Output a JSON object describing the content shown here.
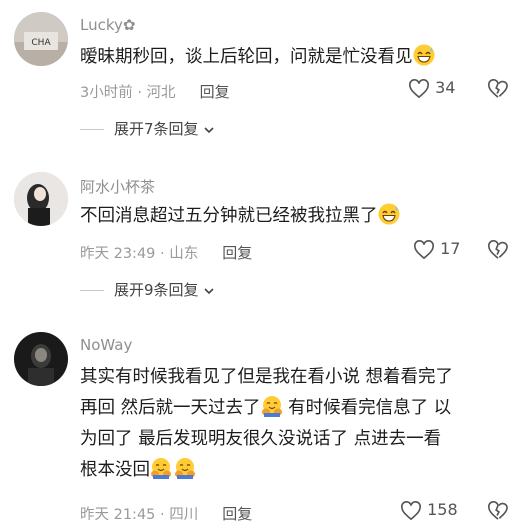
{
  "comments": [
    {
      "username": "Lucky✿",
      "text": "暧昧期秒回，谈上后轮回，问就是忙没看见",
      "emoji_after": "grinning-sweat",
      "time_location": "3小时前 · 河北",
      "reply_label": "回复",
      "likes": "34",
      "expand_label": "展开7条回复"
    },
    {
      "username": "阿水小杯茶",
      "text": "不回消息超过五分钟就已经被我拉黑了",
      "emoji_after": "grinning-sweat",
      "time_location": "昨天 23:49 · 山东",
      "reply_label": "回复",
      "likes": "17",
      "expand_label": "展开9条回复"
    },
    {
      "username": "NoWay",
      "text_line1": "其实有时候我看见了但是我在看小说 想着看完了",
      "text_line2a": "再回 然后就一天过去了",
      "text_line2b": " 有时候看完信息了 以",
      "text_line3": "为回了 最后发现明友很久没说话了 点进去一看",
      "text_line4": "根本没回",
      "emoji_inline": "hugging",
      "time_location": "昨天 21:45 · 四川",
      "reply_label": "回复",
      "likes": "158"
    }
  ]
}
